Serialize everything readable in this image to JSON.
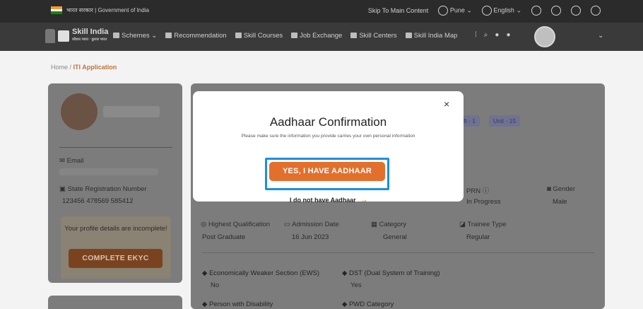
{
  "gov_bar": {
    "title": "भारत सरकार | Government of India",
    "skip": "Skip To Main Content",
    "location": "Pune",
    "language": "English"
  },
  "nav": {
    "brand": "Skill India",
    "brand_sub": "कौशल भारत · कुशल भारत",
    "items": [
      "Schemes",
      "Recommendation",
      "Skill Courses",
      "Job Exchange",
      "Skill Centers",
      "Skill India Map"
    ]
  },
  "breadcrumb": {
    "home": "Home /",
    "current": "ITI Application"
  },
  "profile": {
    "email_label": "Email",
    "srn_label": "State Registration Number",
    "srn_value": "123456 478569 585412",
    "incomplete_text": "Your profile details are incomplete!",
    "ekyc_button": "COMPLETE EKYC"
  },
  "main": {
    "tags": [
      "ft - 1",
      "Unit - 15"
    ],
    "fields": [
      {
        "label": "PRN",
        "value": "In Progress"
      },
      {
        "label": "Gender",
        "value": "Male"
      },
      {
        "label": "Highest Qualification",
        "value": "Post Graduate"
      },
      {
        "label": "Admission Date",
        "value": "16 Jun 2023"
      },
      {
        "label": "Category",
        "value": "General"
      },
      {
        "label": "Trainee Type",
        "value": "Regular"
      }
    ],
    "bullets": [
      {
        "label": "Economically Weaker Section (EWS)",
        "value": "No"
      },
      {
        "label": "DST (Dual System of Training)",
        "value": "Yes"
      },
      {
        "label": "Person with Disability",
        "value": ""
      },
      {
        "label": "PWD Category",
        "value": ""
      }
    ]
  },
  "modal": {
    "title": "Aadhaar Confirmation",
    "subtitle": "Please make sure the information you provide carries your own personal information",
    "yes_button": "YES, I HAVE AADHAAR",
    "no_link": "I do not have Aadhaar",
    "close": "×"
  },
  "colors": {
    "accent_orange": "#e26f2b",
    "highlight_blue": "#1a8fe3"
  }
}
